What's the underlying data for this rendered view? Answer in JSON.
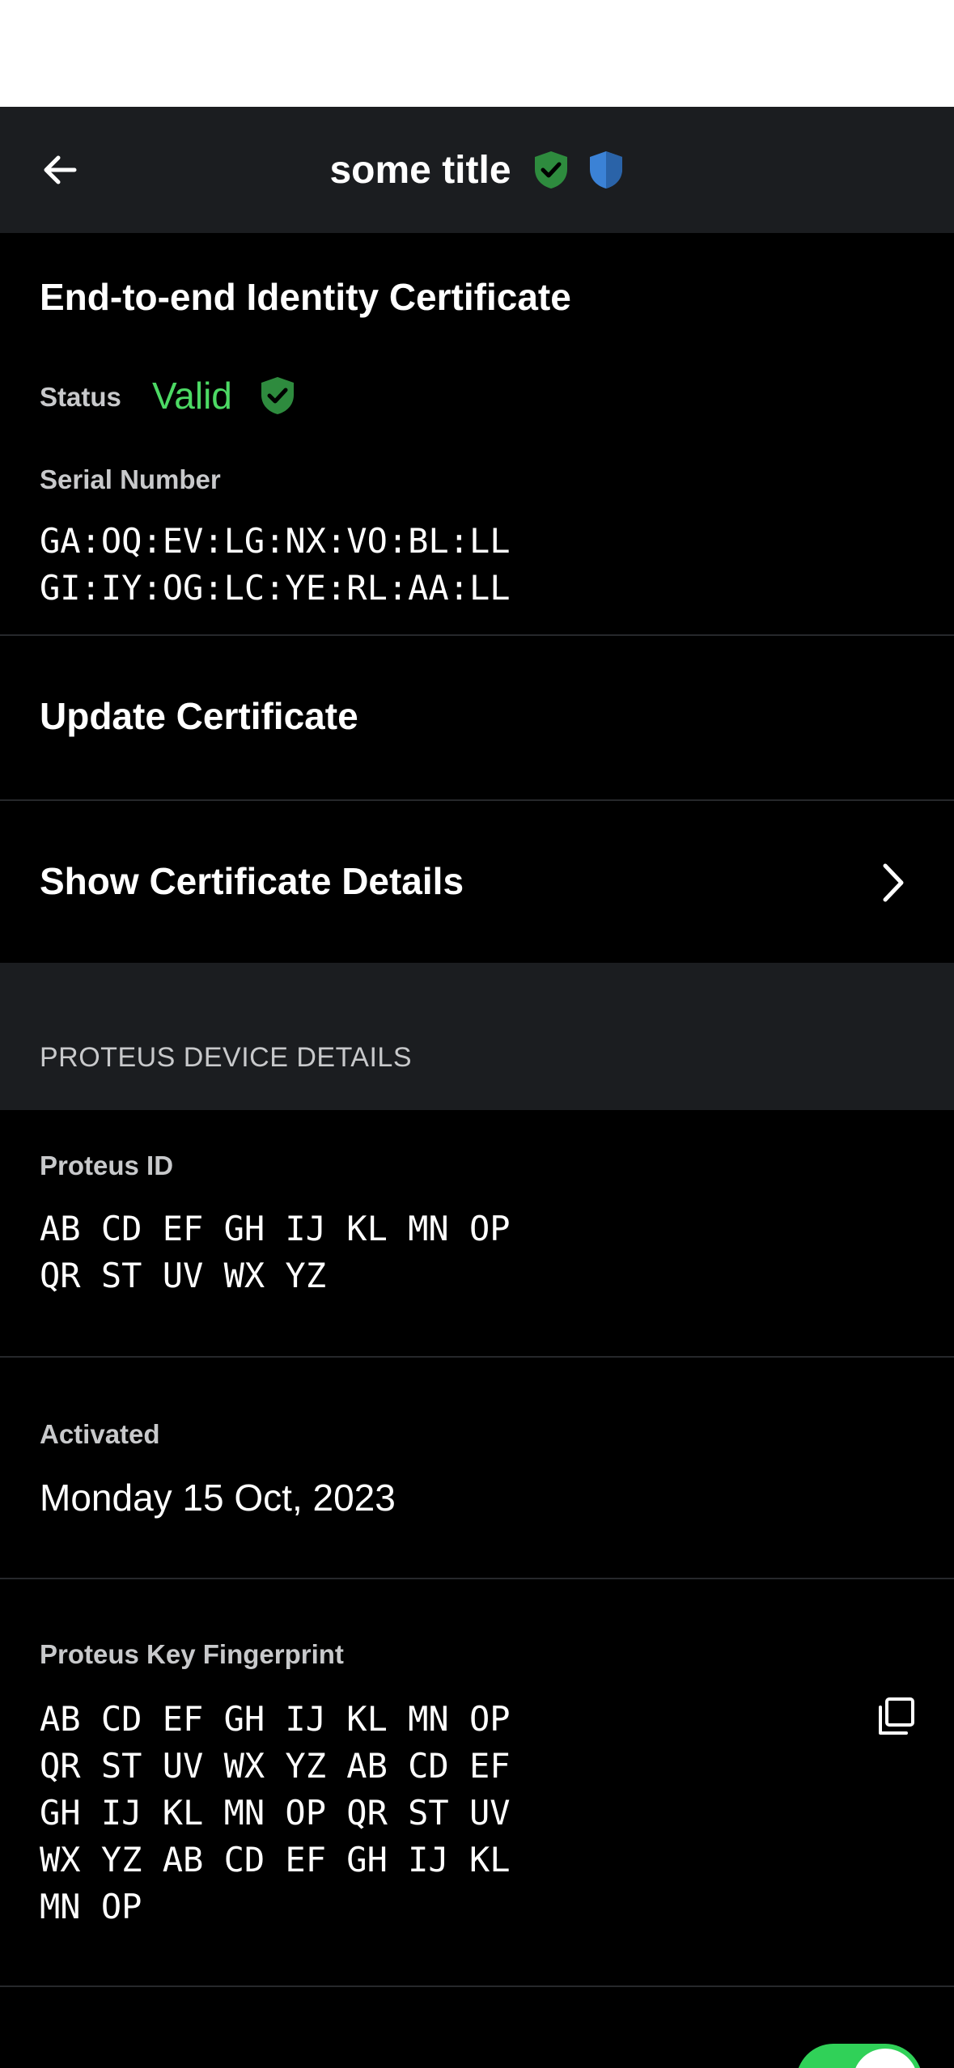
{
  "nav": {
    "title": "some title",
    "back_icon": "arrow-left-icon",
    "badges": [
      "green-shield-check-icon",
      "blue-shield-icon"
    ]
  },
  "certificate": {
    "heading": "End-to-end Identity Certificate",
    "status_label": "Status",
    "status_value": "Valid",
    "serial_label": "Serial Number",
    "serial_number": "GA:OQ:EV:LG:NX:VO:BL:LL\nGI:IY:OG:LC:YE:RL:AA:LL",
    "update_label": "Update Certificate",
    "details_label": "Show Certificate Details"
  },
  "proteus": {
    "section_header": "PROTEUS DEVICE DETAILS",
    "id_label": "Proteus ID",
    "id_value": "AB CD EF GH IJ KL MN OP\nQR ST UV WX YZ",
    "activated_label": "Activated",
    "activated_value": "Monday 15 Oct, 2023",
    "fingerprint_label": "Proteus Key Fingerprint",
    "fingerprint_value": "AB CD EF GH IJ KL MN OP\nQR ST UV WX YZ AB CD EF\nGH IJ KL MN OP QR ST UV\nWX YZ AB CD EF GH IJ KL\nMN OP",
    "copy_icon": "copy-icon"
  },
  "verified": {
    "toggle_on": true
  },
  "colors": {
    "nav_bg": "#1b1d20",
    "valid_green": "#4cd964",
    "shield_green": "#2e8b3e",
    "shield_blue": "#3b82d6",
    "toggle_green": "#30d158"
  }
}
